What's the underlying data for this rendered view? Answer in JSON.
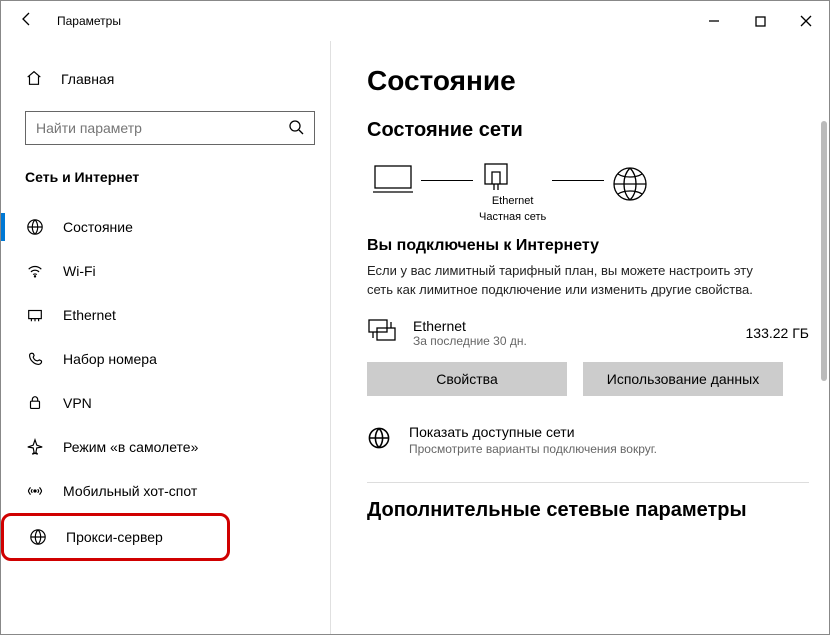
{
  "titlebar": {
    "title": "Параметры"
  },
  "sidebar": {
    "home": "Главная",
    "search_placeholder": "Найти параметр",
    "section": "Сеть и Интернет",
    "items": [
      {
        "label": "Состояние"
      },
      {
        "label": "Wi-Fi"
      },
      {
        "label": "Ethernet"
      },
      {
        "label": "Набор номера"
      },
      {
        "label": "VPN"
      },
      {
        "label": "Режим «в самолете»"
      },
      {
        "label": "Мобильный хот-спот"
      },
      {
        "label": "Прокси-сервер"
      }
    ]
  },
  "main": {
    "title": "Состояние",
    "subtitle": "Состояние сети",
    "diagram": {
      "center_name": "Ethernet",
      "center_type": "Частная сеть"
    },
    "connected": {
      "title": "Вы подключены к Интернету",
      "desc": "Если у вас лимитный тарифный план, вы можете настроить эту сеть как лимитное подключение или изменить другие свойства."
    },
    "usage": {
      "name": "Ethernet",
      "period": "За последние 30 дн.",
      "amount": "133.22 ГБ"
    },
    "buttons": {
      "properties": "Свойства",
      "data_usage": "Использование данных"
    },
    "available": {
      "title": "Показать доступные сети",
      "desc": "Просмотрите варианты подключения вокруг."
    },
    "advanced": "Дополнительные сетевые параметры"
  }
}
